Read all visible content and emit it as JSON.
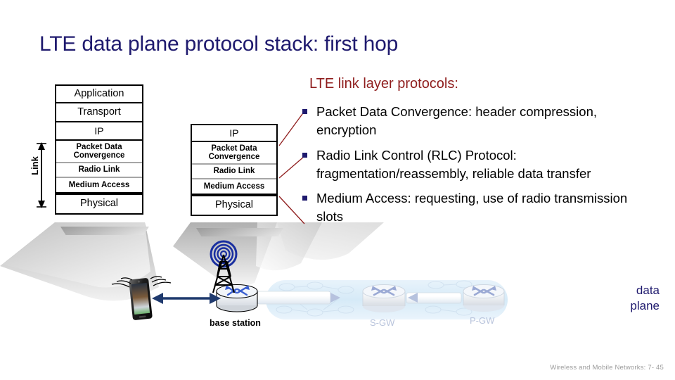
{
  "slide": {
    "title": "LTE data plane protocol stack: first hop",
    "footer": "Wireless and Mobile Networks: 7- 45",
    "title_color": "#1f1a6e",
    "heading_color": "#8f1d1d",
    "bullet_color": "#1f1a6e",
    "connector_color": "#8f1d1d",
    "arrow_color": "#1f3a6e",
    "tower_color": "#1a2fa0",
    "cloud_color": "#dcecf8",
    "footer_color": "#9b9b9b"
  },
  "stacks": {
    "device": {
      "name": "device-protocol-stack",
      "layers": [
        {
          "label": "Application",
          "size": "big"
        },
        {
          "label": "Transport",
          "size": "big"
        },
        {
          "label": "IP",
          "size": "mid"
        }
      ],
      "link_sublayers": [
        {
          "label": "Packet Data Convergence"
        },
        {
          "label": "Radio Link"
        },
        {
          "label": "Medium Access"
        }
      ],
      "physical": {
        "label": "Physical",
        "size": "big"
      }
    },
    "base_station": {
      "name": "base-station-protocol-stack",
      "layers": [
        {
          "label": "IP",
          "size": "mid"
        }
      ],
      "link_sublayers": [
        {
          "label": "Packet Data Convergence"
        },
        {
          "label": "Radio Link"
        },
        {
          "label": "Medium Access"
        }
      ],
      "physical": {
        "label": "Physical",
        "size": "big"
      }
    },
    "link_bracket_label": "Link"
  },
  "protocols_panel": {
    "heading": "LTE link layer protocols:",
    "bullets": [
      "Packet Data Convergence: header compression, encryption",
      "Radio Link Control (RLC) Protocol: fragmentation/reassembly, reliable data transfer",
      "Medium Access: requesting, use of radio transmission slots"
    ]
  },
  "network": {
    "device_label": "",
    "base_station_label": "base station",
    "sgw_label": "S-GW",
    "pgw_label": "P-GW",
    "data_plane_label_line1": "data",
    "data_plane_label_line2": "plane"
  }
}
